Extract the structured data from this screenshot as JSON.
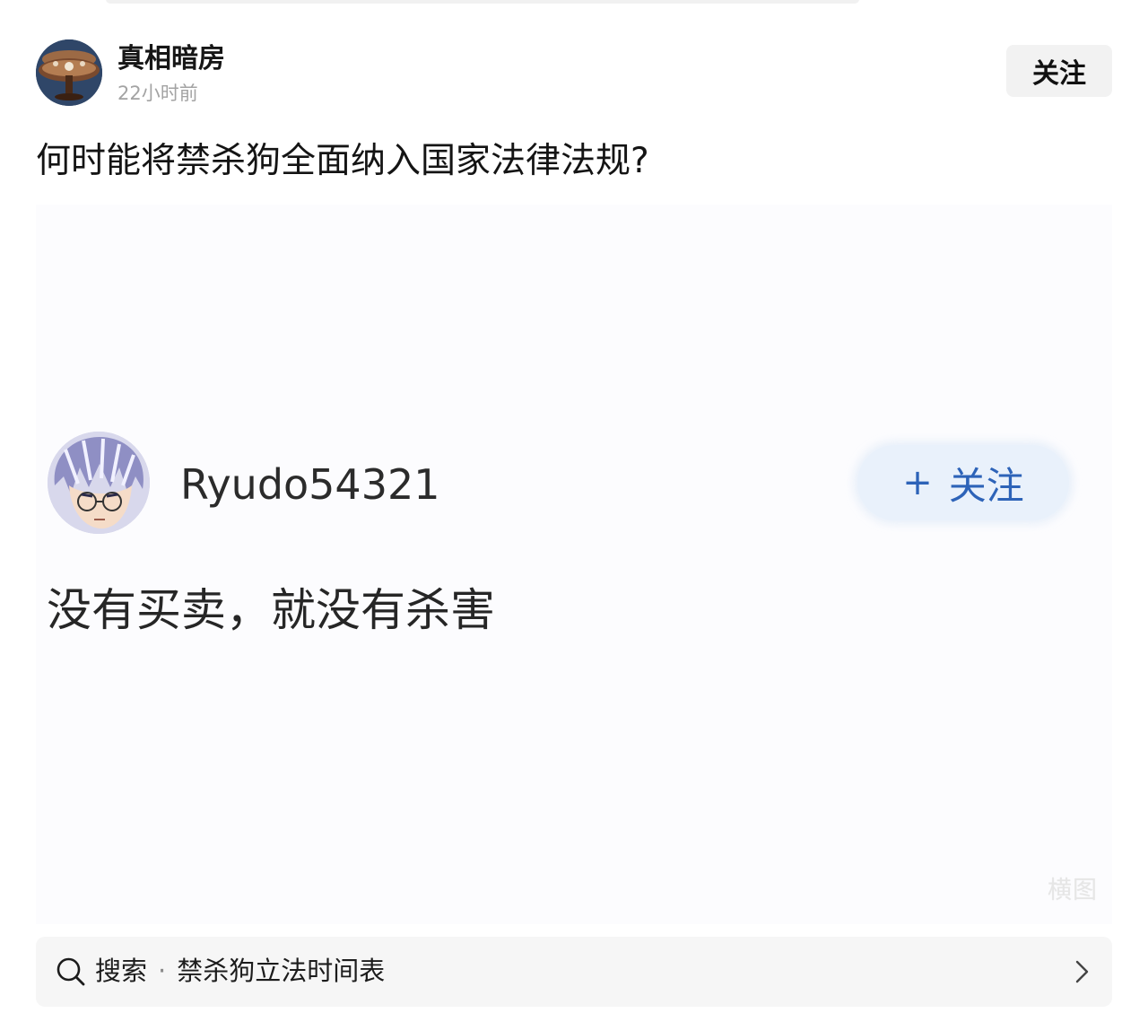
{
  "post": {
    "author": {
      "name": "真相暗房",
      "time": "22小时前",
      "avatar_icon": "avatar-round-table-icon"
    },
    "follow_label": "关注",
    "title": "何时能将禁杀狗全面纳入国家法律法规?",
    "image": {
      "background": "#fcfcfe",
      "badge": "横图",
      "comment_card": {
        "username": "Ryudo54321",
        "follow_plus": "+",
        "follow_label": "关注",
        "comment": "没有买卖，就没有杀害",
        "avatar_icon": "anime-character-avatar-icon"
      }
    }
  },
  "search": {
    "prefix": "搜索",
    "separator": "·",
    "query": "禁杀狗立法时间表",
    "icon": "search-icon",
    "chevron": "chevron-right-icon"
  },
  "colors": {
    "accent_blue": "#2d63b8",
    "follow_bg": "#f2f2f2",
    "meta_gray": "#a3a3a3"
  }
}
